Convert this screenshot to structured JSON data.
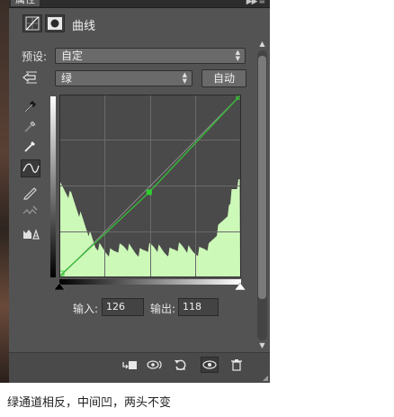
{
  "panel": {
    "tab_label": "属性",
    "menu_icon": "panel-menu-icon",
    "title": "曲线"
  },
  "preset": {
    "label": "预设:",
    "value": "自定"
  },
  "channel": {
    "value": "绿"
  },
  "auto_button": "自动",
  "tools": [
    "on-image-adjust-icon",
    "sample-black-eyedropper-icon",
    "sample-gray-eyedropper-icon",
    "sample-white-eyedropper-icon",
    "edit-points-curve-icon",
    "draw-curve-pencil-icon",
    "smooth-curve-icon",
    "clipping-warning-icon"
  ],
  "curve": {
    "points": [
      [
        0,
        0
      ],
      [
        126,
        118
      ],
      [
        255,
        255
      ]
    ],
    "selected_point": [
      126,
      118
    ],
    "channel_color": "#38b838",
    "histogram_color": "#ccf8b8"
  },
  "input_output": {
    "input_label": "输入:",
    "input_value": "126",
    "output_label": "输出:",
    "output_value": "118"
  },
  "bottom_icons": [
    "clip-to-layer-icon",
    "view-previous-state-icon",
    "reset-icon",
    "toggle-visibility-icon",
    "delete-icon"
  ],
  "caption": "绿通道相反，中间凹，两头不变"
}
